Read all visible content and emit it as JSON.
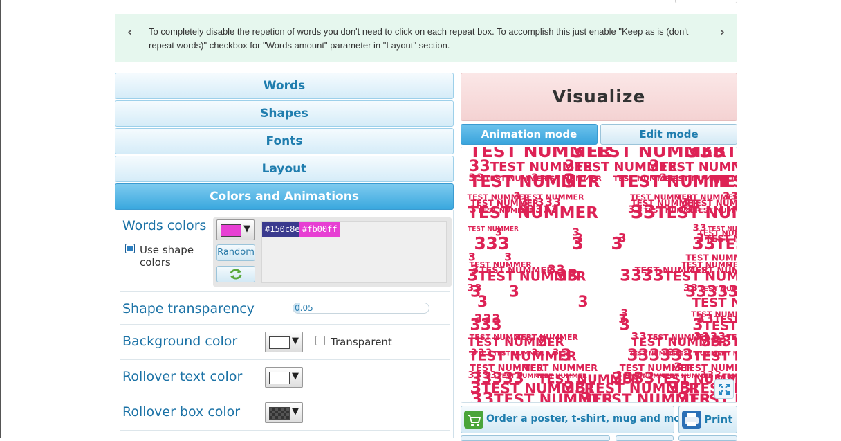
{
  "tip": {
    "text": "To completely disable the repetion of words you don't need to click on each repeat box. To accomplish this just enable \"Keep as is (don't repeat words)\" checkbox for \"Words amount\" parameter in \"Layout\" section.",
    "prev_icon": "chevron-left-icon",
    "next_icon": "chevron-right-icon"
  },
  "tabs": {
    "words": "Words",
    "shapes": "Shapes",
    "fonts": "Fonts",
    "layout": "Layout",
    "colors": "Colors and Animations"
  },
  "colors_panel": {
    "words_colors_label": "Words colors",
    "current_swatch": "#e73fd3",
    "use_shape_colors_label": "Use shape colors",
    "use_shape_colors_checked": true,
    "random_label": "Random",
    "refresh_icon": "refresh-icon",
    "color_chips": [
      {
        "label": "#150c8e",
        "bg": "#3a3a8e"
      },
      {
        "label": "#fb00ff",
        "bg": "#e73fd3"
      }
    ],
    "shape_transparency_label": "Shape transparency",
    "shape_transparency_value": "0.05",
    "background_color_label": "Background color",
    "background_color": "#ffffff",
    "transparent_label": "Transparent",
    "transparent_checked": false,
    "rollover_text_label": "Rollover text color",
    "rollover_text_color": "#ffffff",
    "rollover_box_label": "Rollover box color",
    "rollover_box_color": "#333333"
  },
  "visualize": {
    "label": "Visualize",
    "animation_mode": "Animation mode",
    "edit_mode": "Edit mode"
  },
  "canvas": {
    "word_big": "TEST NUMMER",
    "word_small": "3",
    "word_color": "#dd2255"
  },
  "actions": {
    "order_label": "Order a poster, t-shirt, mug and more",
    "order_icon": "cart-icon",
    "print_label": "Print",
    "print_icon": "printer-icon",
    "expand_icon": "expand-icon"
  }
}
